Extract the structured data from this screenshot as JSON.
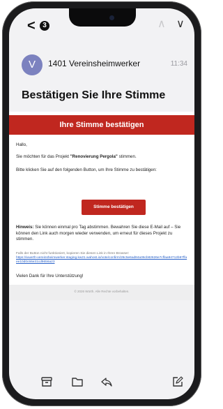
{
  "status": {
    "badge_count": "3"
  },
  "email": {
    "sender_initial": "V",
    "sender": "1401 Vereinsheimwerker",
    "time": "11:34",
    "subject": "Bestätigen Sie Ihre Stimme",
    "banner": "Ihre Stimme bestätigen",
    "greeting": "Hallo,",
    "line1_prefix": "Sie möchten für das Projekt ",
    "project": "\"Renovierung Pergola\"",
    "line1_suffix": " stimmen.",
    "line2": "Bitte klicken Sie auf den folgenden Button, um Ihre Stimme zu bestätigen:",
    "button": "Stimme bestätigen",
    "hint_label": "Hinweis:",
    "hint_text": " Sie können einmal pro Tag abstimmen. Bewahren Sie diese E-Mail auf – Sie können den Link auch morgen wieder verwenden, um erneut für dieses Projekt zu stimmen.",
    "fallback_text": "Falls der Button nicht funktioniert, kopieren Sie diesen Link in Ihren Browser:",
    "fallback_link": "https://wuerth-vereinsheimwerker.staging.kw21.wahost.io/vote/confirm/26c5e6ad84a36cb82626e7cffaa94712b97ffaee10d0c66e31cd9656a23",
    "thanks": "Vielen Dank für Ihre Unterstützung!",
    "copyright": "© 2026 Würth. Alle Rechte vorbehalten."
  },
  "toolbar": {
    "archive_icon": "archive-icon",
    "folder_icon": "folder-icon",
    "reply_icon": "reply-icon",
    "compose_icon": "compose-icon"
  }
}
